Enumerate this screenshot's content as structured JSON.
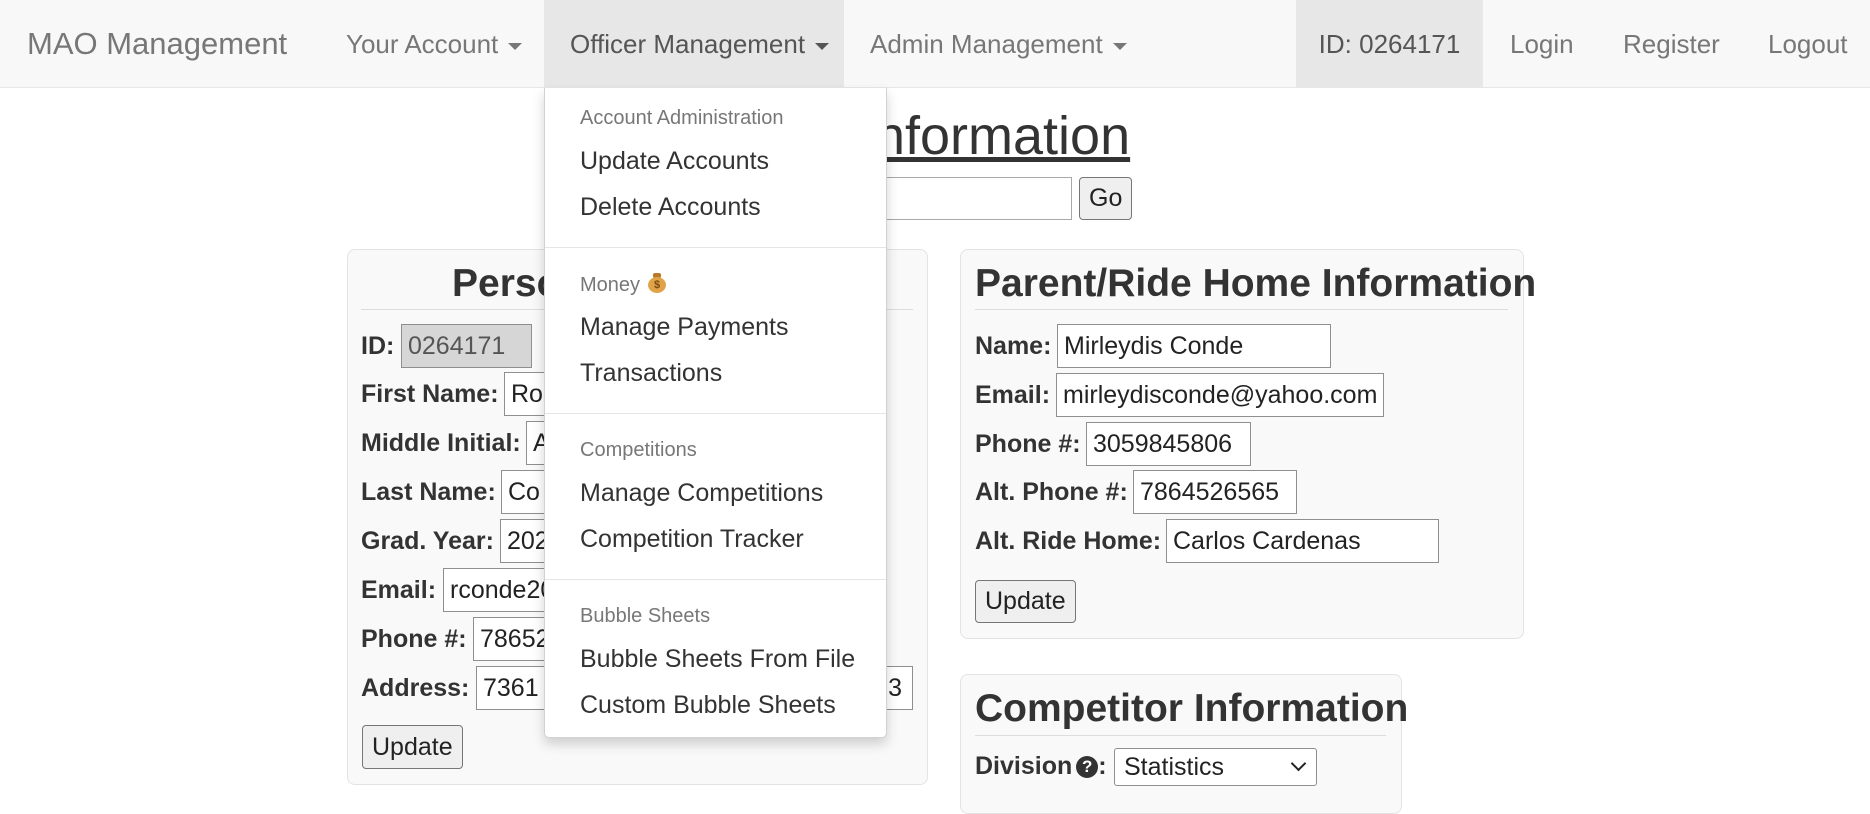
{
  "navbar": {
    "brand": "MAO Management",
    "your_account": "Your Account",
    "officer_management": "Officer Management",
    "admin_management": "Admin Management",
    "user_id": "ID: 0264171",
    "login": "Login",
    "register": "Register",
    "logout": "Logout"
  },
  "dropdown": {
    "sections": [
      {
        "header": "Account Administration",
        "items": [
          "Update Accounts",
          "Delete Accounts"
        ]
      },
      {
        "header": "Money",
        "header_icon": "money-bag-icon",
        "items": [
          "Manage Payments",
          "Transactions"
        ]
      },
      {
        "header": "Competitions",
        "items": [
          "Manage Competitions",
          "Competition Tracker"
        ]
      },
      {
        "header": "Bubble Sheets",
        "items": [
          "Bubble Sheets From File",
          "Custom Bubble Sheets"
        ]
      }
    ]
  },
  "page": {
    "title_visible": "ount Information",
    "go_label": "Go"
  },
  "personal": {
    "title_visible": "Perso",
    "id_label": "ID:",
    "id_value": "0264171",
    "first_name_label": "First Name:",
    "first_name_visible": "Ro",
    "middle_initial_label": "Middle Initial:",
    "middle_initial_visible": "A",
    "last_name_label": "Last Name:",
    "last_name_visible": "Co",
    "grad_year_label": "Grad. Year:",
    "grad_year_visible": "202",
    "email_label": "Email:",
    "email_visible": "rconde20",
    "phone_label": "Phone #:",
    "phone_visible": "78652",
    "address_label": "Address:",
    "address_visible": "7361",
    "address_tail_visible": "3",
    "update_label": "Update"
  },
  "parent": {
    "title": "Parent/Ride Home Information",
    "name_label": "Name:",
    "name_value": "Mirleydis Conde",
    "email_label": "Email:",
    "email_value": "mirleydisconde@yahoo.com",
    "phone_label": "Phone #:",
    "phone_value": "3059845806",
    "alt_phone_label": "Alt. Phone #:",
    "alt_phone_value": "7864526565",
    "alt_ride_label": "Alt. Ride Home:",
    "alt_ride_value": "Carlos Cardenas",
    "update_label": "Update"
  },
  "competitor": {
    "title": "Competitor Information",
    "division_label": "Division",
    "division_selected": "Statistics"
  }
}
